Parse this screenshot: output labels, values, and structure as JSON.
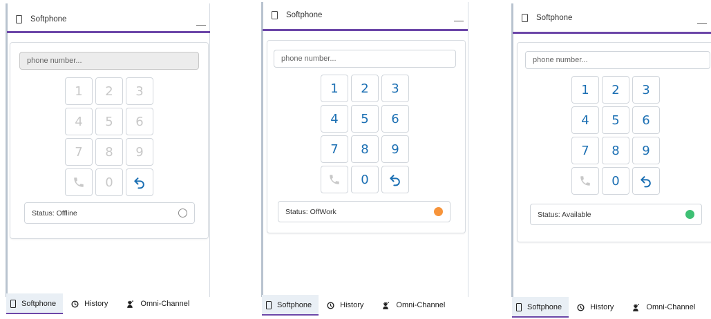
{
  "panels": [
    {
      "id": "offline",
      "title": "Softphone",
      "minimize_symbol": "—",
      "phone_placeholder": "phone number...",
      "input_disabled": true,
      "keys": [
        "1",
        "2",
        "3",
        "4",
        "5",
        "6",
        "7",
        "8",
        "9",
        "call",
        "0",
        "undo"
      ],
      "digits_enabled": false,
      "status_text": "Status: Offline",
      "status_state": "offline",
      "status_color": "#ffffff",
      "tabs": [
        "Softphone",
        "History",
        "Omni-Channel"
      ],
      "active_tab": "Softphone"
    },
    {
      "id": "offwork",
      "title": "Softphone",
      "minimize_symbol": "—",
      "phone_placeholder": "phone number...",
      "input_disabled": false,
      "keys": [
        "1",
        "2",
        "3",
        "4",
        "5",
        "6",
        "7",
        "8",
        "9",
        "call",
        "0",
        "undo"
      ],
      "digits_enabled": true,
      "status_text": "Status: OffWork",
      "status_state": "offwork",
      "status_color": "#f7943a",
      "tabs": [
        "Softphone",
        "History",
        "Omni-Channel"
      ],
      "active_tab": "Softphone"
    },
    {
      "id": "available",
      "title": "Softphone",
      "minimize_symbol": "—",
      "phone_placeholder": "phone number...",
      "input_disabled": false,
      "keys": [
        "1",
        "2",
        "3",
        "4",
        "5",
        "6",
        "7",
        "8",
        "9",
        "call",
        "0",
        "undo"
      ],
      "digits_enabled": true,
      "status_text": "Status: Available",
      "status_state": "available",
      "status_color": "#3ec074",
      "tabs": [
        "Softphone",
        "History",
        "Omni-Channel"
      ],
      "active_tab": "Softphone"
    }
  ],
  "colors": {
    "accent_purple": "#6c46a8",
    "key_blue": "#1b6fb3",
    "disabled_gray": "#c8c8c8"
  },
  "icons": {
    "title": "mobile-phone-icon",
    "call": "phone-handset-icon",
    "undo": "undo-arrow-icon",
    "softphone_tab": "mobile-phone-icon",
    "history_tab": "clock-icon",
    "omni_tab": "headset-person-icon"
  }
}
